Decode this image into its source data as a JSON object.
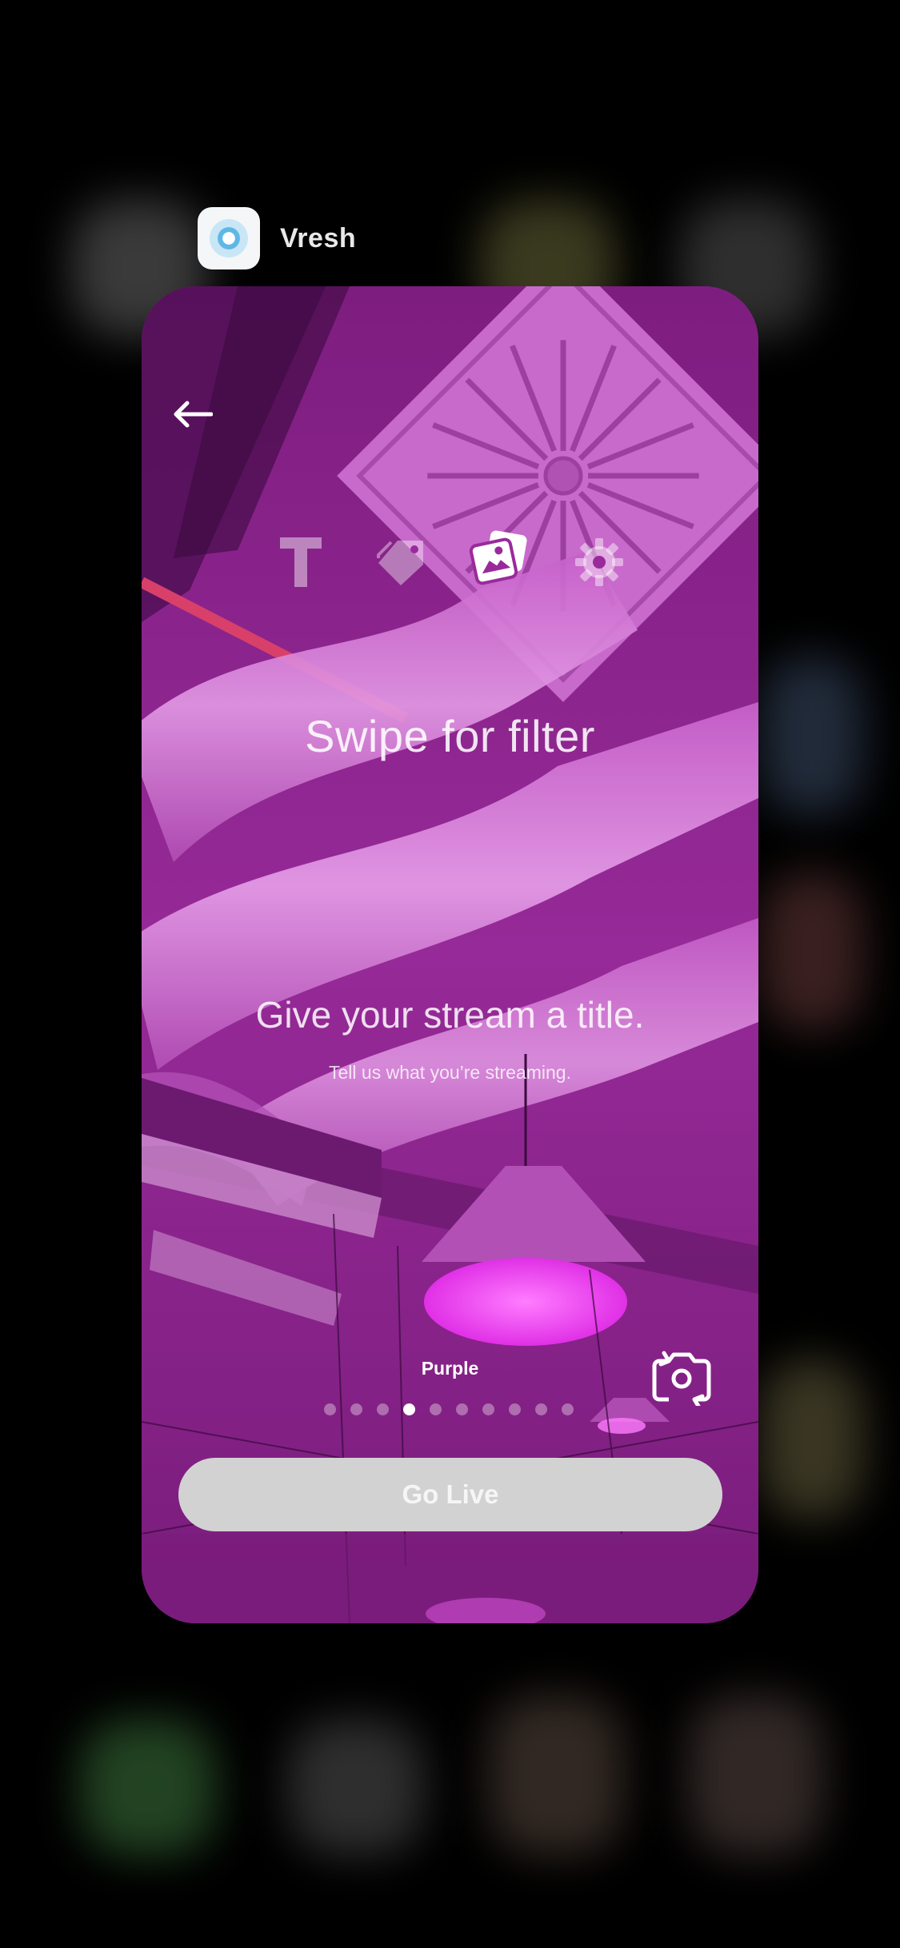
{
  "app": {
    "name": "Vresh",
    "icon": "vresh-app-icon"
  },
  "stream_setup": {
    "back_icon": "arrow-left-icon",
    "toolbar": [
      {
        "icon": "text-icon",
        "active": false
      },
      {
        "icon": "tag-icon",
        "active": false
      },
      {
        "icon": "photos-icon",
        "active": true
      },
      {
        "icon": "gear-icon",
        "active": false
      }
    ],
    "swipe_hint": "Swipe for filter",
    "title_prompt": "Give your stream a title.",
    "title_subtext": "Tell us what you’re streaming.",
    "filter": {
      "name": "Purple",
      "page_count": 10,
      "active_index": 3
    },
    "flip_camera_icon": "camera-flip-icon",
    "go_live_label": "Go Live"
  },
  "colors": {
    "background": "#000000",
    "camera_tint": "#9a2a9c",
    "go_live_button": "#d2d2d2"
  }
}
